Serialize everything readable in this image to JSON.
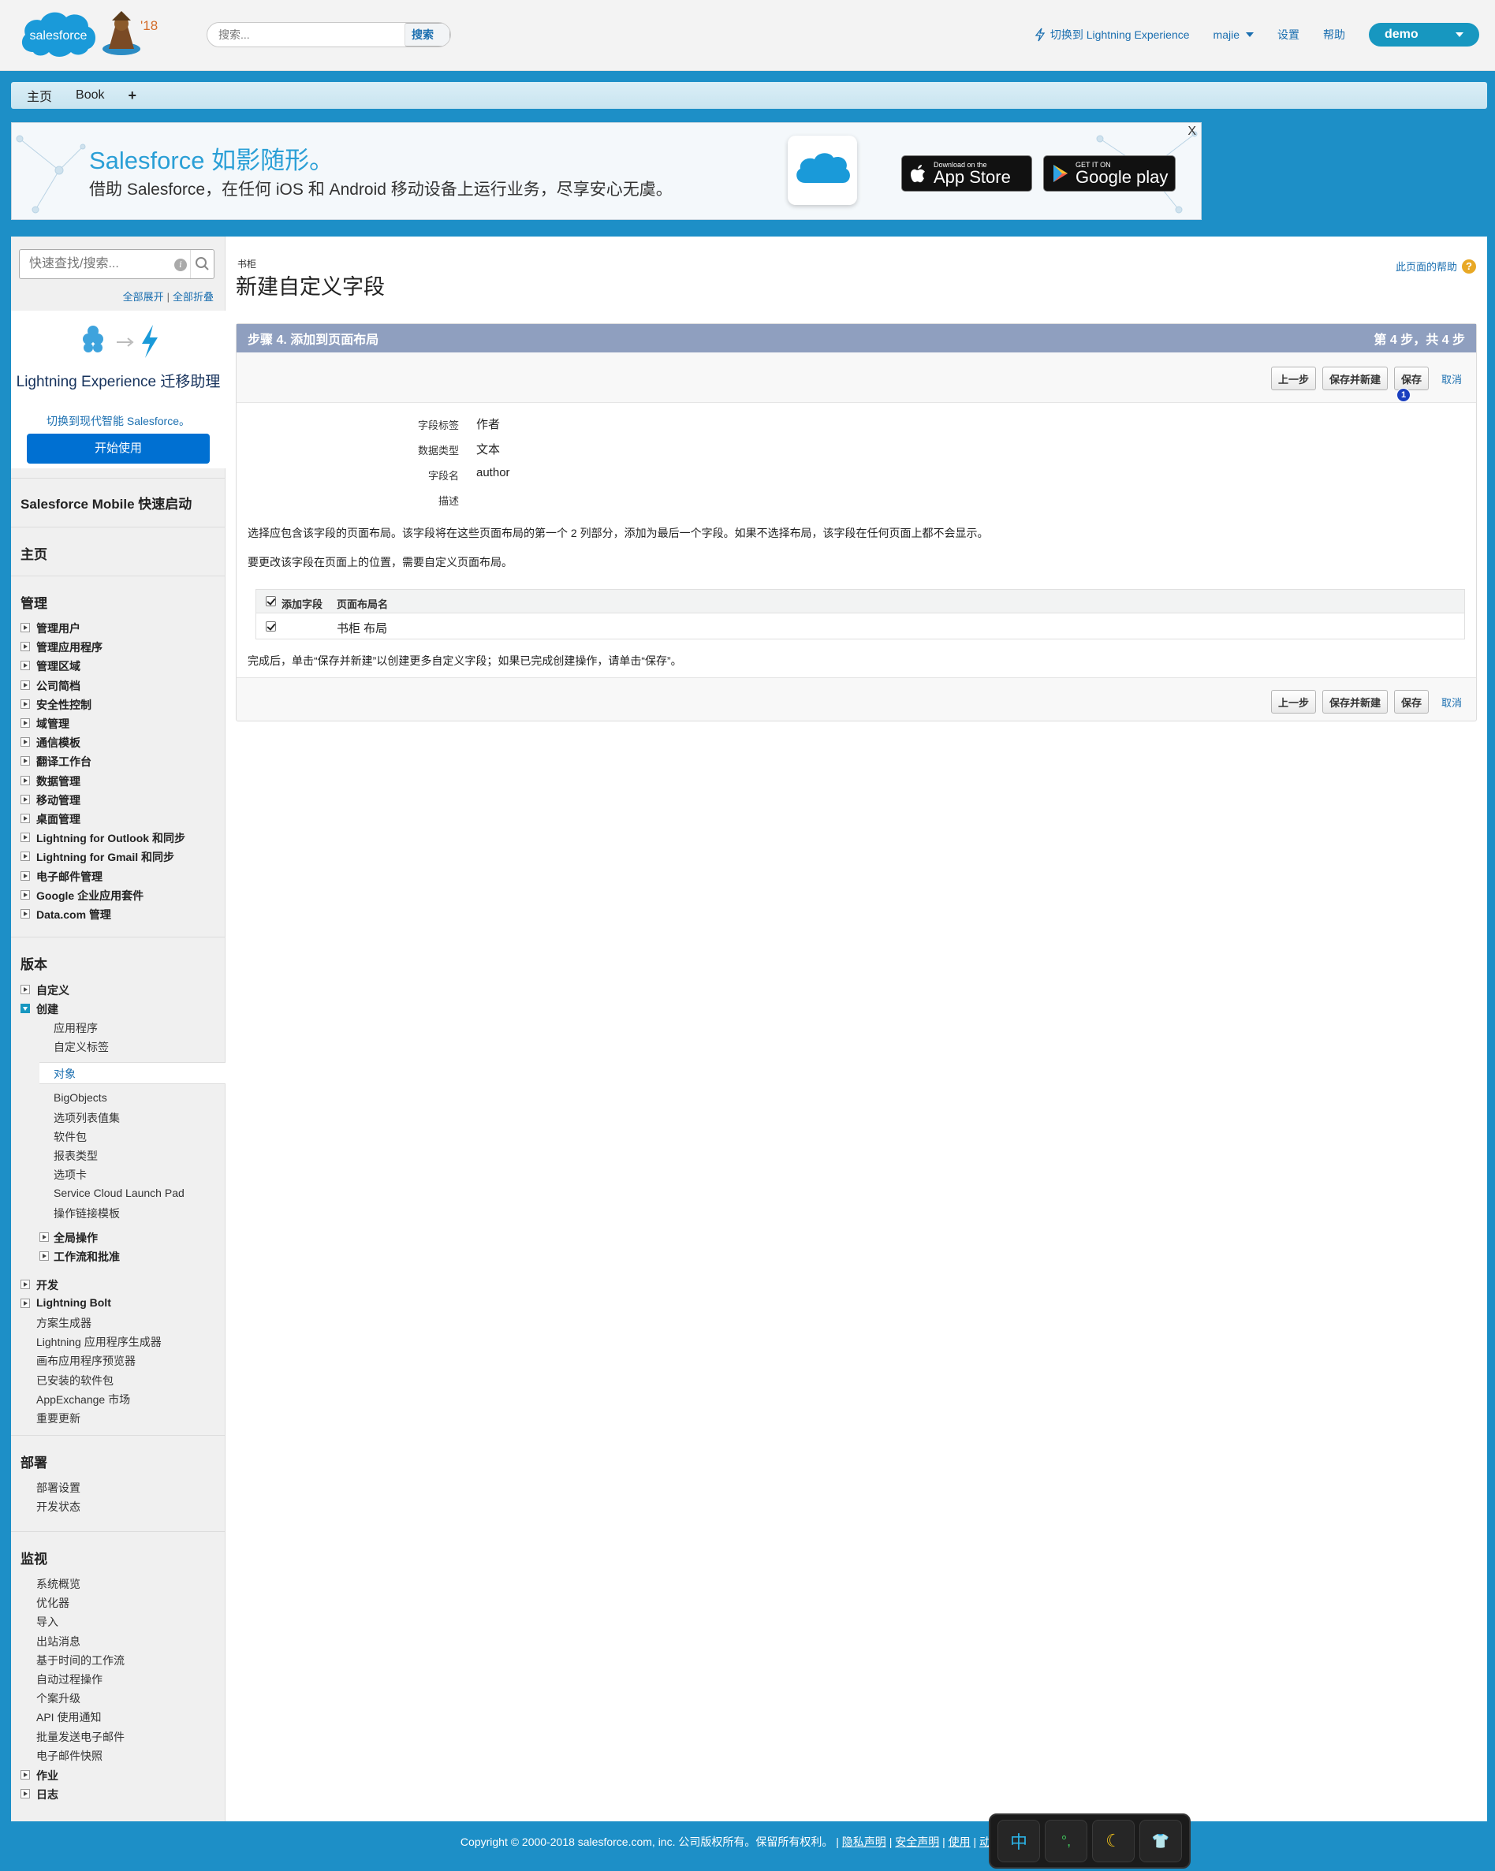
{
  "header": {
    "logo_text": "salesforce",
    "mascot_badge": "'18",
    "search_placeholder": "搜索...",
    "search_button": "搜索",
    "switch_lightning": "切换到 Lightning Experience",
    "user_name": "majie",
    "setup": "设置",
    "help": "帮助",
    "org_name": "demo"
  },
  "tabs": [
    {
      "label": "主页"
    },
    {
      "label": "Book"
    },
    {
      "label": "+"
    }
  ],
  "banner": {
    "title": "Salesforce 如影随形。",
    "subtitle": "借助 Salesforce，在任何 iOS 和 Android 移动设备上运行业务，尽享安心无虞。",
    "appstore_small": "Download on the",
    "appstore_big": "App Store",
    "googleplay_small": "GET IT ON",
    "googleplay_big": "Google play",
    "close": "X"
  },
  "sidebar": {
    "quickfind_placeholder": "快速查找/搜索...",
    "expand_all": "全部展开",
    "collapse_all": "全部折叠",
    "lex_title": "Lightning Experience 迁移助理",
    "lex_sub": "切换到现代智能 Salesforce。",
    "lex_button": "开始使用",
    "mobile_quickstart": "Salesforce Mobile 快速启动",
    "home": "主页",
    "admin_heading": "管理",
    "admin_items": [
      "管理用户",
      "管理应用程序",
      "管理区域",
      "公司简档",
      "安全性控制",
      "域管理",
      "通信模板",
      "翻译工作台",
      "数据管理",
      "移动管理",
      "桌面管理",
      "Lightning for Outlook 和同步",
      "Lightning for Gmail 和同步",
      "电子邮件管理",
      "Google 企业应用套件",
      "Data.com 管理"
    ],
    "build_heading": "版本",
    "build_customize": "自定义",
    "build_create": "创建",
    "create_items": [
      "应用程序",
      "自定义标签",
      "对象",
      "BigObjects",
      "选项列表值集",
      "软件包",
      "报表类型",
      "选项卡",
      "Service Cloud Launch Pad",
      "操作链接模板"
    ],
    "create_sub_expandable": [
      "全局操作",
      "工作流和批准"
    ],
    "develop": "开发",
    "lightning_bolt": "Lightning Bolt",
    "build_links": [
      "方案生成器",
      "Lightning 应用程序生成器",
      "画布应用程序预览器",
      "已安装的软件包",
      "AppExchange 市场",
      "重要更新"
    ],
    "deploy_heading": "部署",
    "deploy_items": [
      "部署设置",
      "开发状态"
    ],
    "monitor_heading": "监视",
    "monitor_items": [
      "系统概览",
      "优化器",
      "导入",
      "出站消息",
      "基于时间的工作流",
      "自动过程操作",
      "个案升级",
      "API 使用通知",
      "批量发送电子邮件",
      "电子邮件快照"
    ],
    "monitor_expandable": [
      "作业",
      "日志"
    ]
  },
  "content": {
    "breadcrumb": "书柜",
    "title": "新建自定义字段",
    "help_link": "此页面的帮助",
    "step_title": "步骤 4. 添加到页面布局",
    "step_counter": "第 4 步，共 4 步",
    "buttons": {
      "previous": "上一步",
      "save_new": "保存并新建",
      "save": "保存",
      "cancel": "取消"
    },
    "badge": "1",
    "fields": [
      {
        "label": "字段标签",
        "value": "作者"
      },
      {
        "label": "数据类型",
        "value": "文本"
      },
      {
        "label": "字段名",
        "value": "author"
      },
      {
        "label": "描述",
        "value": ""
      }
    ],
    "instruction_1": "选择应包含该字段的页面布局。该字段将在这些页面布局的第一个 2 列部分，添加为最后一个字段。如果不选择布局，该字段在任何页面上都不会显示。",
    "instruction_2": "要更改该字段在页面上的位置，需要自定义页面布局。",
    "table": {
      "col_add": "添加字段",
      "col_layout": "页面布局名",
      "rows": [
        {
          "checked": true,
          "layout": "书柜 布局"
        }
      ]
    },
    "instruction_3": "完成后，单击“保存并新建”以创建更多自定义字段；如果已完成创建操作，请单击“保存”。"
  },
  "footer": {
    "copyright": "Copyright © 2000-2018 salesforce.com, inc. 公司版权所有。保留所有权利。",
    "privacy": "隐私声明",
    "security": "安全声明",
    "use": "使用",
    "apps": "动应用程序"
  },
  "ime": {
    "keys": [
      "中",
      "°,",
      "☾",
      "👕"
    ]
  }
}
